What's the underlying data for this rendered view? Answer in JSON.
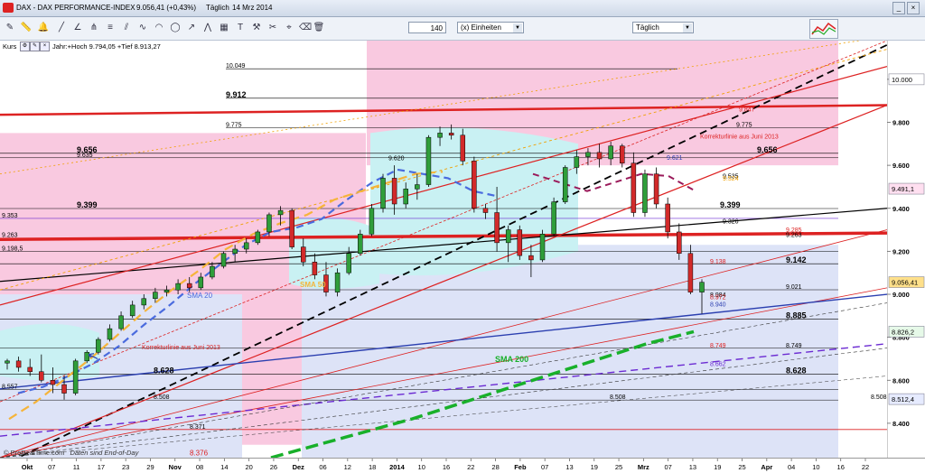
{
  "window": {
    "title": "DAX - DAX PERFORMANCE-INDEX",
    "quote": "9.056,41 (+0,43%)",
    "interval": "Täglich",
    "date": "14 Mrz 2014"
  },
  "toolbar": {
    "period_value": "140",
    "unit_label": "(x) Einheiten",
    "interval_select": "Täglich",
    "icons": [
      "pencil-icon",
      "ruler-icon",
      "bell-icon",
      "line-icon",
      "angle-line-icon",
      "pitchfork-icon",
      "fibonacci-icon",
      "channel-icon",
      "wave-icon",
      "arc-icon",
      "grid-icon",
      "text-icon",
      "trash-icon"
    ]
  },
  "subbar": {
    "label": "Kurs",
    "info": "Jahr:+Hoch 9.794,05 +Tief 8.913,27"
  },
  "footer": {
    "credit": "© ProRealTime.com",
    "note": "Daten sind End-of-Day"
  },
  "colors": {
    "up": "#2f9e3a",
    "down": "#d22a2a",
    "pink_zone": "#f9c9e0",
    "blue_zone": "#dde3f7",
    "cyan_zone": "#c9f1f3",
    "sma20": "#4a6bde",
    "sma50": "#f5b43a",
    "sma200": "#18b02a"
  },
  "chart_data": {
    "type": "candlestick",
    "title": "DAX - DAX PERFORMANCE-INDEX",
    "interval": "Täglich",
    "y_range": [
      8240,
      10180
    ],
    "y_ticks": [
      "8.400",
      "8.600",
      "8.800",
      "9.000",
      "9.200",
      "9.400",
      "9.600",
      "9.800",
      "10.000"
    ],
    "x_ticks": [
      "Okt",
      "07",
      "11",
      "17",
      "23",
      "29",
      "Nov",
      "08",
      "14",
      "20",
      "26",
      "Dez",
      "06",
      "12",
      "18",
      "2014",
      "10",
      "16",
      "22",
      "28",
      "Feb",
      "07",
      "13",
      "19",
      "25",
      "Mrz",
      "07",
      "13",
      "19",
      "25",
      "Apr",
      "04",
      "10",
      "16",
      "22"
    ],
    "price_boxes": [
      {
        "text": "10.000",
        "color": "#ffffff"
      },
      {
        "text": "9.491,1",
        "color": "#ffdff0"
      },
      {
        "text": "9.056,41",
        "color": "#ffe08a"
      },
      {
        "text": "8.826,2",
        "color": "#e6f9e8"
      },
      {
        "text": "8.512,4",
        "color": "#e6ebff"
      }
    ],
    "moving_averages": [
      {
        "name": "SMA 20",
        "color": "#4a6bde",
        "values": [
          8540,
          8570,
          8620,
          8680,
          8760,
          8860,
          8950,
          9050,
          9140,
          9230,
          9290,
          9310,
          9350,
          9440,
          9520,
          9580,
          9560,
          9540,
          9480,
          9455
        ]
      },
      {
        "name": "SMA 50",
        "color": "#f5b43a",
        "values": [
          8420,
          8500,
          8600,
          8700,
          8810,
          8920,
          9020,
          9110,
          9210,
          9280,
          9330,
          9370,
          9440,
          9480,
          9520,
          9560,
          9570
        ]
      },
      {
        "name": "SMA 200",
        "color": "#18b02a",
        "values": [
          8240,
          8300,
          8360,
          8420,
          8490,
          8560,
          8630,
          8700,
          8770,
          8826
        ]
      }
    ],
    "horizontal_levels": [
      "10.049",
      "9.912",
      "9.775",
      "9.656",
      "9.635",
      "9.399",
      "9.353",
      "9.263",
      "9.198,5",
      "9.142",
      "9.021",
      "8.885",
      "8.749",
      "8.628",
      "8.557",
      "8.508",
      "8.371"
    ],
    "line_labels": [
      "9.847",
      "9.775",
      "9.656",
      "9.621",
      "9.535",
      "9.524",
      "9.399",
      "9.326",
      "9.285",
      "9.263",
      "9.138",
      "9.021",
      "8.984",
      "8.972",
      "8.940",
      "8.885",
      "8.749",
      "8.749",
      "8.662",
      "8.628",
      "8.508",
      "8.508",
      "9.620",
      "8.376",
      "8.371"
    ],
    "annotations": [
      "Korrekturlinie aus Juni 2013",
      "Korrekturlinie aus Juni 2013",
      "SMA 20",
      "SMA 50",
      "SMA 200"
    ],
    "candles": [
      {
        "o": 8680,
        "h": 8700,
        "l": 8650,
        "c": 8690
      },
      {
        "o": 8690,
        "h": 8710,
        "l": 8640,
        "c": 8660
      },
      {
        "o": 8660,
        "h": 8700,
        "l": 8620,
        "c": 8640
      },
      {
        "o": 8640,
        "h": 8720,
        "l": 8590,
        "c": 8600
      },
      {
        "o": 8600,
        "h": 8660,
        "l": 8540,
        "c": 8580
      },
      {
        "o": 8580,
        "h": 8620,
        "l": 8510,
        "c": 8540
      },
      {
        "o": 8540,
        "h": 8700,
        "l": 8530,
        "c": 8690
      },
      {
        "o": 8690,
        "h": 8740,
        "l": 8680,
        "c": 8730
      },
      {
        "o": 8730,
        "h": 8800,
        "l": 8720,
        "c": 8790
      },
      {
        "o": 8790,
        "h": 8860,
        "l": 8780,
        "c": 8840
      },
      {
        "o": 8840,
        "h": 8920,
        "l": 8830,
        "c": 8900
      },
      {
        "o": 8900,
        "h": 8970,
        "l": 8890,
        "c": 8950
      },
      {
        "o": 8950,
        "h": 9000,
        "l": 8930,
        "c": 8980
      },
      {
        "o": 8980,
        "h": 9030,
        "l": 8960,
        "c": 9010
      },
      {
        "o": 9010,
        "h": 9040,
        "l": 8990,
        "c": 9020
      },
      {
        "o": 9020,
        "h": 9070,
        "l": 9000,
        "c": 9050
      },
      {
        "o": 9050,
        "h": 9080,
        "l": 9010,
        "c": 9030
      },
      {
        "o": 9030,
        "h": 9100,
        "l": 9020,
        "c": 9080
      },
      {
        "o": 9080,
        "h": 9150,
        "l": 9070,
        "c": 9130
      },
      {
        "o": 9130,
        "h": 9200,
        "l": 9120,
        "c": 9190
      },
      {
        "o": 9190,
        "h": 9230,
        "l": 9150,
        "c": 9210
      },
      {
        "o": 9210,
        "h": 9260,
        "l": 9190,
        "c": 9240
      },
      {
        "o": 9240,
        "h": 9300,
        "l": 9230,
        "c": 9290
      },
      {
        "o": 9290,
        "h": 9380,
        "l": 9270,
        "c": 9370
      },
      {
        "o": 9370,
        "h": 9410,
        "l": 9320,
        "c": 9390
      },
      {
        "o": 9390,
        "h": 9400,
        "l": 9210,
        "c": 9220
      },
      {
        "o": 9220,
        "h": 9260,
        "l": 9130,
        "c": 9150
      },
      {
        "o": 9150,
        "h": 9190,
        "l": 9070,
        "c": 9090
      },
      {
        "o": 9090,
        "h": 9150,
        "l": 8990,
        "c": 9010
      },
      {
        "o": 9010,
        "h": 9120,
        "l": 8990,
        "c": 9100
      },
      {
        "o": 9100,
        "h": 9220,
        "l": 9090,
        "c": 9190
      },
      {
        "o": 9190,
        "h": 9300,
        "l": 9180,
        "c": 9280
      },
      {
        "o": 9280,
        "h": 9420,
        "l": 9270,
        "c": 9400
      },
      {
        "o": 9400,
        "h": 9560,
        "l": 9380,
        "c": 9540
      },
      {
        "o": 9540,
        "h": 9600,
        "l": 9370,
        "c": 9420
      },
      {
        "o": 9420,
        "h": 9520,
        "l": 9400,
        "c": 9490
      },
      {
        "o": 9490,
        "h": 9560,
        "l": 9440,
        "c": 9510
      },
      {
        "o": 9510,
        "h": 9740,
        "l": 9500,
        "c": 9730
      },
      {
        "o": 9730,
        "h": 9780,
        "l": 9690,
        "c": 9750
      },
      {
        "o": 9750,
        "h": 9790,
        "l": 9720,
        "c": 9740
      },
      {
        "o": 9740,
        "h": 9770,
        "l": 9600,
        "c": 9620
      },
      {
        "o": 9620,
        "h": 9640,
        "l": 9380,
        "c": 9400
      },
      {
        "o": 9400,
        "h": 9420,
        "l": 9350,
        "c": 9380
      },
      {
        "o": 9380,
        "h": 9500,
        "l": 9200,
        "c": 9240
      },
      {
        "o": 9240,
        "h": 9320,
        "l": 9150,
        "c": 9300
      },
      {
        "o": 9300,
        "h": 9320,
        "l": 9160,
        "c": 9180
      },
      {
        "o": 9180,
        "h": 9230,
        "l": 9080,
        "c": 9160
      },
      {
        "o": 9160,
        "h": 9300,
        "l": 9150,
        "c": 9280
      },
      {
        "o": 9280,
        "h": 9450,
        "l": 9270,
        "c": 9430
      },
      {
        "o": 9430,
        "h": 9600,
        "l": 9420,
        "c": 9590
      },
      {
        "o": 9590,
        "h": 9670,
        "l": 9560,
        "c": 9640
      },
      {
        "o": 9640,
        "h": 9680,
        "l": 9600,
        "c": 9660
      },
      {
        "o": 9660,
        "h": 9700,
        "l": 9590,
        "c": 9630
      },
      {
        "o": 9630,
        "h": 9710,
        "l": 9600,
        "c": 9690
      },
      {
        "o": 9690,
        "h": 9700,
        "l": 9590,
        "c": 9610
      },
      {
        "o": 9610,
        "h": 9660,
        "l": 9360,
        "c": 9380
      },
      {
        "o": 9380,
        "h": 9580,
        "l": 9360,
        "c": 9560
      },
      {
        "o": 9560,
        "h": 9590,
        "l": 9400,
        "c": 9420
      },
      {
        "o": 9420,
        "h": 9450,
        "l": 9260,
        "c": 9290
      },
      {
        "o": 9290,
        "h": 9330,
        "l": 9160,
        "c": 9190
      },
      {
        "o": 9190,
        "h": 9230,
        "l": 9000,
        "c": 9010
      },
      {
        "o": 9010,
        "h": 9070,
        "l": 8910,
        "c": 9056
      }
    ]
  }
}
